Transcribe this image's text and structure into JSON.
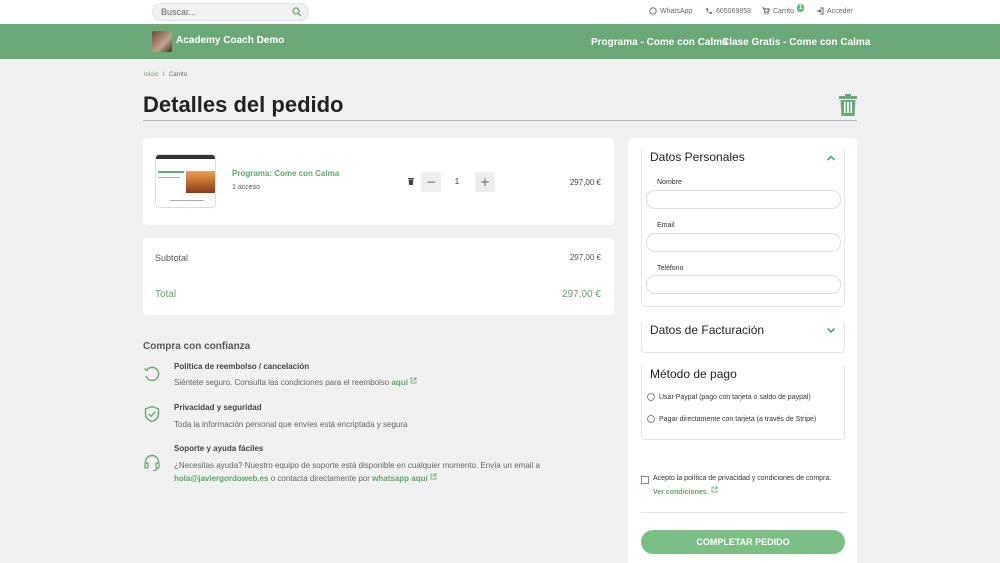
{
  "topbar": {
    "search_placeholder": "Buscar...",
    "whatsapp_label": "WhatsApp",
    "phone": "605069858",
    "cart_label": "Carrito",
    "cart_count": "1",
    "login_label": "Acceder"
  },
  "header": {
    "brand": "Academy Coach Demo",
    "nav": [
      "Programa - Come con Calma",
      "Clase Gratis - Come con Calma"
    ]
  },
  "breadcrumb": {
    "home": "Inicio",
    "separator": "/",
    "current": "Carrito"
  },
  "page": {
    "title": "Detalles del pedido"
  },
  "cart_item": {
    "name": "Programa: Come con Calma",
    "access": "1 acceso",
    "quantity": "1",
    "price": "297,00 €",
    "minus": "−",
    "plus": "+"
  },
  "totals": {
    "subtotal_label": "Subtotal",
    "subtotal_value": "297,00 €",
    "total_label": "Total",
    "total_value": "297,00 €"
  },
  "trust": {
    "title": "Compra con confianza",
    "items": [
      {
        "heading": "Política de reembolso / cancelación",
        "text": "Siéntete seguro. Consulta las condiciones para el reembolso",
        "link": "aquí"
      },
      {
        "heading": "Privacidad y seguridad",
        "text": "Toda la información personal que envíes está encriptada y segura"
      },
      {
        "heading": "Soporte y ayuda fáciles",
        "text": "¿Necesitas ayuda? Nuestro equipo de soporte está disponible en cualquier momento. Envía un email a",
        "email": "hola@javiergordoweb.es",
        "mid": "o contacta directamente por",
        "link": "whatsapp aquí"
      }
    ]
  },
  "personal": {
    "title": "Datos Personales",
    "name_label": "Nombre",
    "email_label": "Email",
    "phone_label": "Teléfono",
    "name_value": "",
    "email_value": "",
    "phone_value": ""
  },
  "billing": {
    "title": "Datos de Facturación"
  },
  "payment": {
    "title": "Método de pago",
    "options": [
      "Usar Paypal (pago con tarjeta o saldo de paypal)",
      "Pagar directamente con tarjeta (a través de Stripe)"
    ]
  },
  "consent": {
    "text": "Acepto la política de privacidad y condiciones de compra.",
    "link": "Ver condiciones."
  },
  "submit_label": "COMPLETAR PEDIDO",
  "colors": {
    "accent": "#6aa878",
    "link": "#5ea46d",
    "button": "#7bbf87"
  },
  "icons": [
    "search-icon",
    "whatsapp-icon",
    "phone-icon",
    "cart-icon",
    "login-icon",
    "trash-icon",
    "refund-icon",
    "shield-icon",
    "headset-icon",
    "external-link-icon",
    "chevron-up-icon",
    "chevron-down-icon"
  ]
}
